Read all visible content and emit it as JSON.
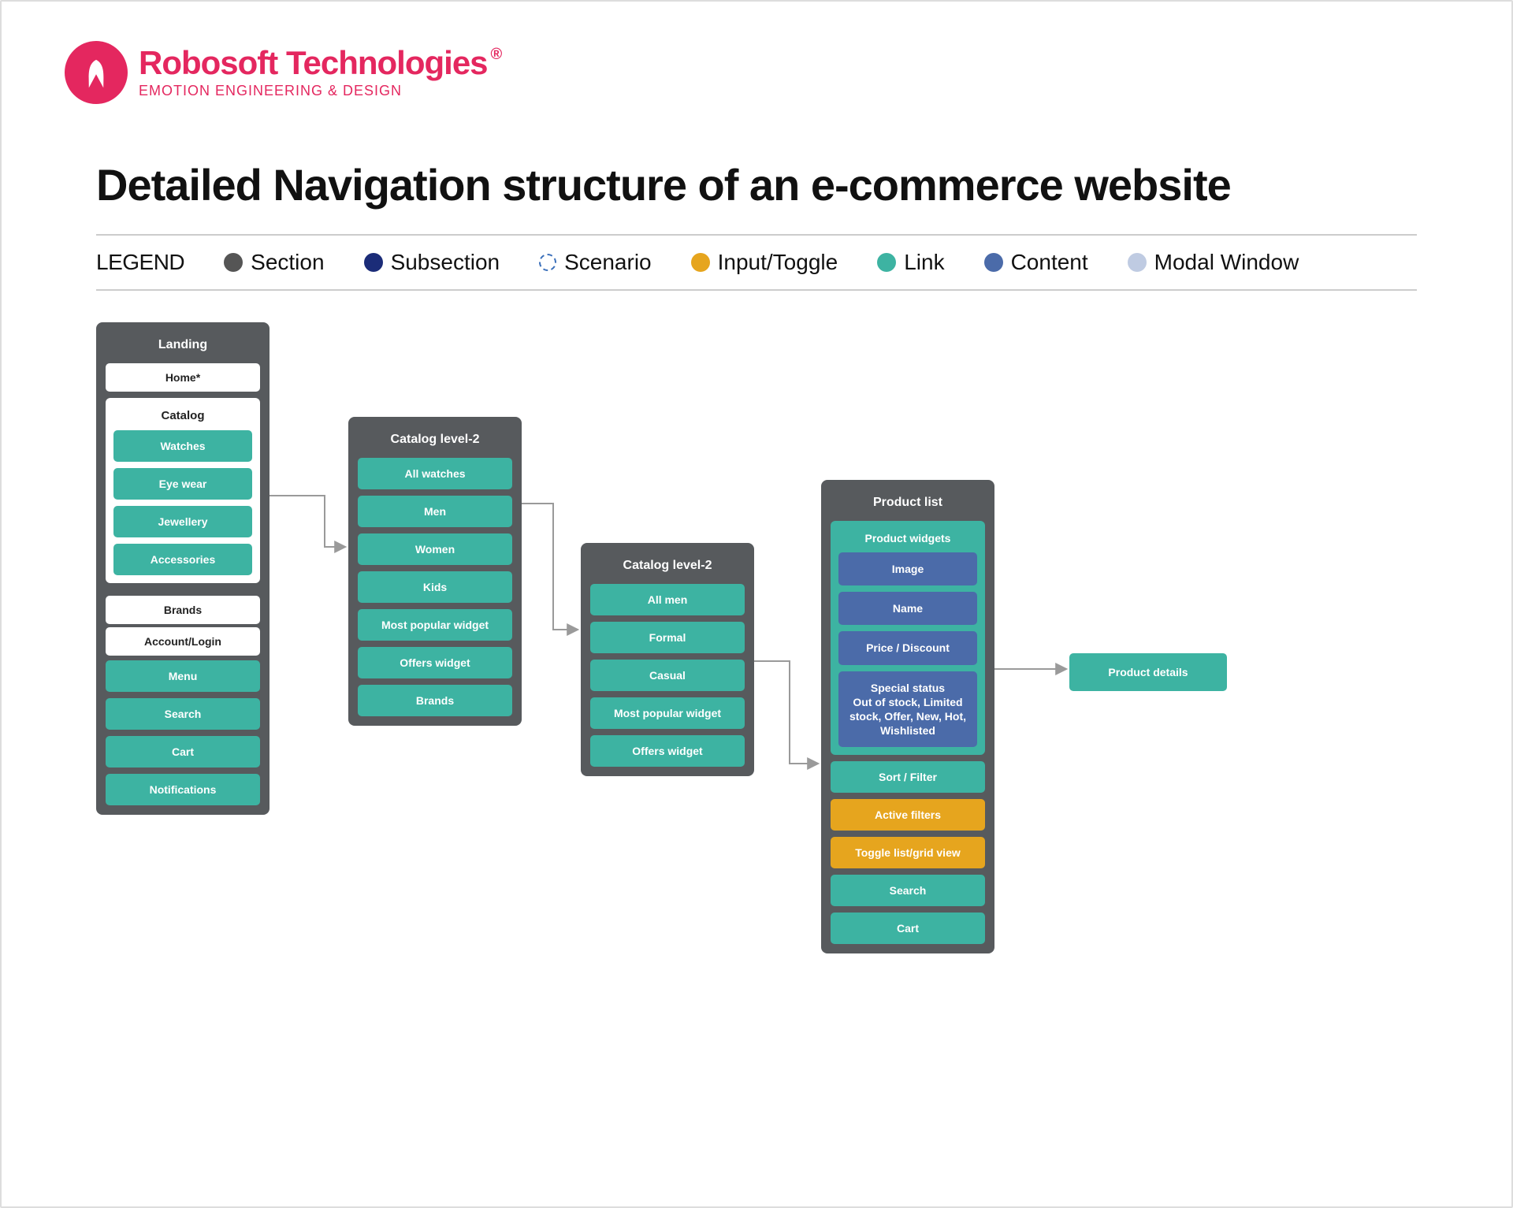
{
  "brand": {
    "name": "Robosoft Technologies",
    "tagline": "EMOTION ENGINEERING & DESIGN"
  },
  "title": "Detailed Navigation structure of an e-commerce website",
  "legend": {
    "label": "LEGEND",
    "items": {
      "section": "Section",
      "subsection": "Subsection",
      "scenario": "Scenario",
      "input": "Input/Toggle",
      "link": "Link",
      "content": "Content",
      "modal": "Modal Window"
    }
  },
  "landing": {
    "title": "Landing",
    "home": "Home*",
    "catalog": {
      "title": "Catalog",
      "items": [
        "Watches",
        "Eye wear",
        "Jewellery",
        "Accessories"
      ]
    },
    "brands": "Brands",
    "account": "Account/Login",
    "bottom": [
      "Menu",
      "Search",
      "Cart",
      "Notifications"
    ]
  },
  "catalogL2a": {
    "title": "Catalog level-2",
    "items": [
      "All watches",
      "Men",
      "Women",
      "Kids",
      "Most popular widget",
      "Offers widget",
      "Brands"
    ]
  },
  "catalogL2b": {
    "title": "Catalog level-2",
    "items": [
      "All men",
      "Formal",
      "Casual",
      "Most popular widget",
      "Offers widget"
    ]
  },
  "productList": {
    "title": "Product list",
    "widgets": {
      "title": "Product widgets",
      "items": [
        "Image",
        "Name",
        "Price / Discount",
        "Special status\nOut of stock, Limited stock, Offer, New, Hot, Wishlisted"
      ]
    },
    "sortFilter": "Sort / Filter",
    "activeFilters": "Active filters",
    "toggleView": "Toggle list/grid view",
    "search": "Search",
    "cart": "Cart"
  },
  "endpoint": "Product details"
}
